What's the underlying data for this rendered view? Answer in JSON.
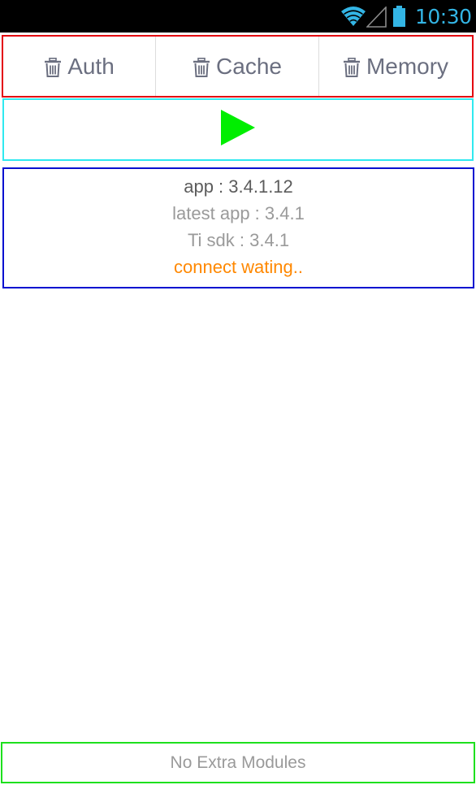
{
  "status_bar": {
    "time": "10:30",
    "time_color": "#33b5e5",
    "icons": [
      "wifi-icon",
      "signal-icon",
      "battery-icon"
    ]
  },
  "clear_buttons": [
    {
      "label": "Auth",
      "icon": "trash-icon"
    },
    {
      "label": "Cache",
      "icon": "trash-icon"
    },
    {
      "label": "Memory",
      "icon": "trash-icon"
    }
  ],
  "play": {
    "icon": "play-icon",
    "color": "#00ee00"
  },
  "info": {
    "app_version": "app : 3.4.1.12",
    "latest_app": "latest app : 3.4.1",
    "ti_sdk": "Ti sdk : 3.4.1",
    "connection_status": "connect wating..",
    "status_color": "#ff8800"
  },
  "footer": {
    "modules_text": "No Extra Modules"
  },
  "colors": {
    "clear_row_border": "#e3000f",
    "play_row_border": "#2fe9f0",
    "info_border": "#0010d0",
    "footer_border": "#1de01d"
  }
}
